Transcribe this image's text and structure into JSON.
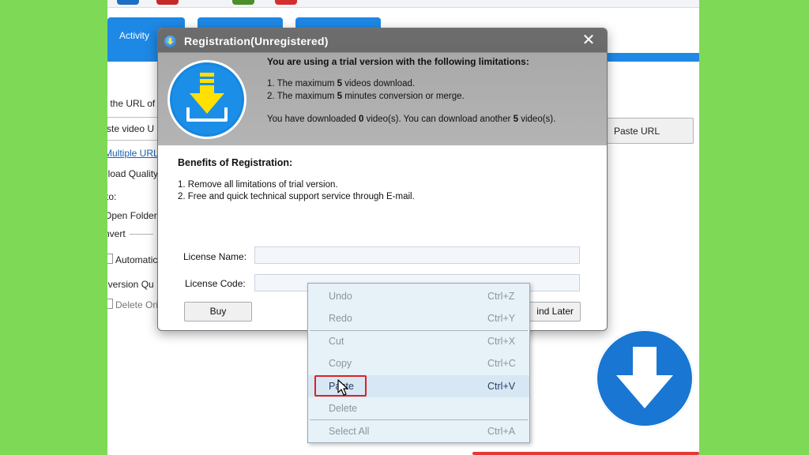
{
  "app": {
    "tabs": [
      {
        "label": "Activity"
      },
      {
        "label": ""
      },
      {
        "label": ""
      }
    ],
    "url_prompt": "r the URL of",
    "url_input_value": "ste video U",
    "paste_url_label": "Paste URL",
    "multiple_urls_link": "Multiple URLs",
    "download_quality_label": "nload Quality",
    "save_to_label": "to:",
    "open_folder_label": "Open Folder",
    "convert_label": "nvert",
    "automatic_label": "Automatic",
    "conversion_quality_label": "nversion Qu",
    "delete_original_label": "Delete Ori"
  },
  "dialog": {
    "title": "Registration(Unregistered)",
    "close_glyph": "✕",
    "trial_heading": "You are using a trial version with the following limitations:",
    "limit1_pre": "1. The maximum ",
    "limit1_num": "5",
    "limit1_post": " videos download.",
    "limit2_pre": "2. The maximum ",
    "limit2_num": "5",
    "limit2_post": " minutes conversion or merge.",
    "status_pre": "You have downloaded ",
    "status_downloaded": "0",
    "status_mid": " video(s). You can download another ",
    "status_remaining": "5",
    "status_post": " video(s).",
    "benefits_heading": "Benefits of Registration:",
    "benefit1": "1. Remove all limitations of trial version.",
    "benefit2": "2. Free and quick technical support service through E-mail.",
    "license_name_label": "License Name:",
    "license_name_value": "",
    "license_code_label": "License Code:",
    "license_code_value": "",
    "buy_label": "Buy",
    "remind_later_label": "ind Later"
  },
  "context_menu": {
    "items": [
      {
        "label": "Undo",
        "shortcut": "Ctrl+Z"
      },
      {
        "label": "Redo",
        "shortcut": "Ctrl+Y"
      },
      {
        "label": "Cut",
        "shortcut": "Ctrl+X"
      },
      {
        "label": "Copy",
        "shortcut": "Ctrl+C"
      },
      {
        "label": "Paste",
        "shortcut": "Ctrl+V"
      },
      {
        "label": "Delete",
        "shortcut": ""
      },
      {
        "label": "Select All",
        "shortcut": "Ctrl+A"
      }
    ],
    "highlighted_item": "Paste"
  },
  "colors": {
    "background_green": "#7ed957",
    "accent_blue": "#1e88e5",
    "highlight_red": "#e02020"
  },
  "icons": [
    "app-logo-icon",
    "title-download-icon",
    "close-icon",
    "download-arrow-icon",
    "mouse-cursor-icon"
  ]
}
